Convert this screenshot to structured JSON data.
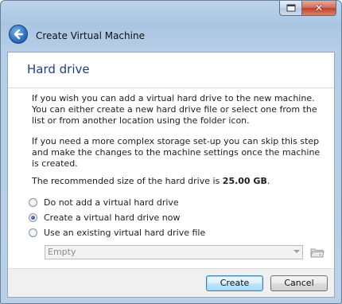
{
  "window": {
    "title": "Create Virtual Machine",
    "caption_buttons": [
      "restore-icon",
      "close-icon"
    ]
  },
  "page": {
    "heading": "Hard drive",
    "paragraph1": "If you wish you can add a virtual hard drive to the new machine. You can either create a new hard drive file or select one from the list or from another location using the folder icon.",
    "paragraph2": "If you need a more complex storage set-up you can skip this step and make the changes to the machine settings once the machine is created.",
    "recommended_prefix": "The recommended size of the hard drive is ",
    "recommended_size": "25.00 GB",
    "recommended_suffix": "."
  },
  "options": [
    {
      "label": "Do not add a virtual hard drive",
      "checked": false
    },
    {
      "label": "Create a virtual hard drive now",
      "checked": true
    },
    {
      "label": "Use an existing virtual hard drive file",
      "checked": false
    }
  ],
  "existing_file": {
    "selected_value": "Empty",
    "enabled": false
  },
  "buttons": {
    "create": "Create",
    "cancel": "Cancel"
  }
}
